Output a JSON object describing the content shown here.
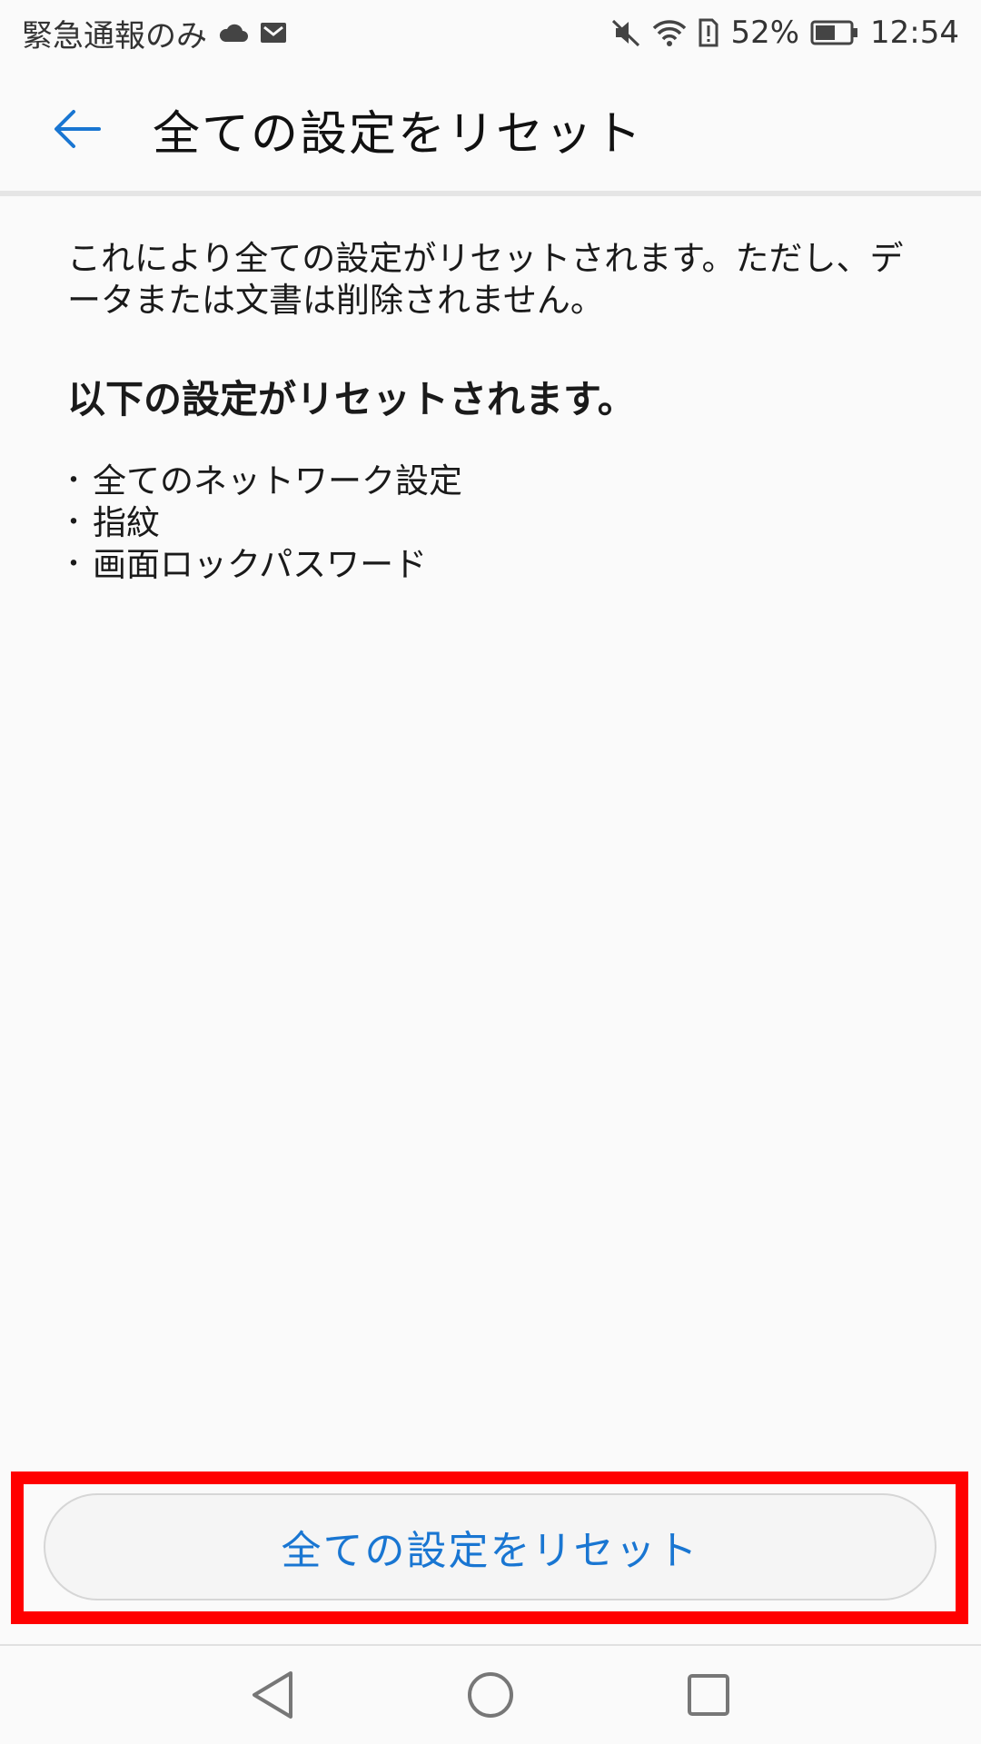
{
  "status_bar": {
    "carrier_text": "緊急通報のみ",
    "battery_percent": "52%",
    "time": "12:54",
    "icons": [
      "cloud-icon",
      "gmail-icon",
      "mute-icon",
      "wifi-icon",
      "sim-alert-icon",
      "battery-icon"
    ]
  },
  "header": {
    "title": "全ての設定をリセット"
  },
  "main": {
    "description": "これにより全ての設定がリセットされます。ただし、データまたは文書は削除されません。",
    "section_title": "以下の設定がリセットされます。",
    "items": [
      {
        "label": "全てのネットワーク設定"
      },
      {
        "label": "指紋"
      },
      {
        "label": "画面ロックパスワード"
      }
    ],
    "bullet": "・"
  },
  "button": {
    "label": "全ての設定をリセット"
  },
  "colors": {
    "accent": "#1976d2",
    "highlight": "#ff0000",
    "background": "#fafafa"
  }
}
